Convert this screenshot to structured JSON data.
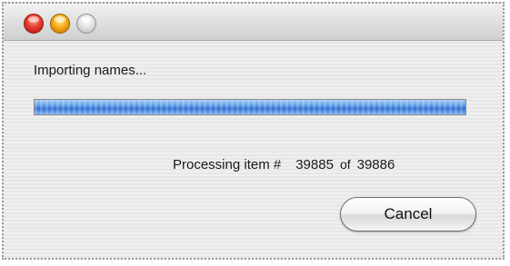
{
  "window": {
    "traffic_lights": [
      {
        "name": "close-button",
        "color": "#e63b2d"
      },
      {
        "name": "minimize-button",
        "color": "#f4ad1a"
      },
      {
        "name": "zoom-button",
        "color": "#d0d0d0"
      }
    ]
  },
  "dialog": {
    "status_text": "Importing names...",
    "progress": {
      "fraction": 0.9999,
      "fill_color": "#3f80dc"
    },
    "processing": {
      "label": "Processing item #",
      "current": "39885",
      "of_word": "of",
      "total": "39886"
    },
    "cancel_label": "Cancel"
  }
}
